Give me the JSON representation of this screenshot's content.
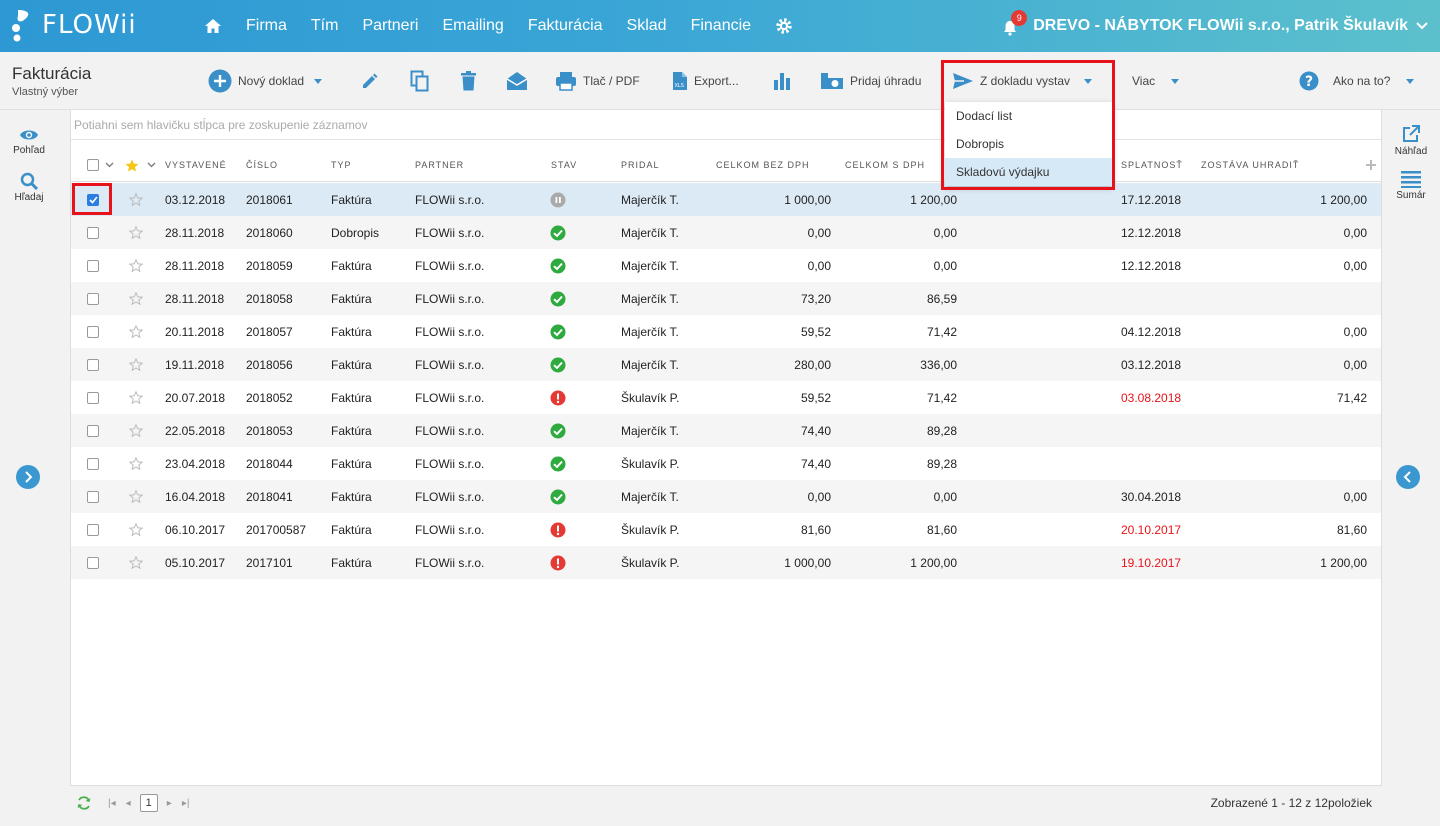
{
  "app": {
    "logo_text": "FLOWii",
    "brand_color": "#3399d6",
    "accent_color": "#3a8fc9"
  },
  "nav": {
    "items": [
      "Firma",
      "Tím",
      "Partneri",
      "Emailing",
      "Fakturácia",
      "Sklad",
      "Financie"
    ]
  },
  "user": {
    "notif_count": "9",
    "company": "DREVO - NÁBYTOK FLOWii s.r.o., Patrik Škulavík"
  },
  "page": {
    "title": "Fakturácia",
    "subtitle": "Vlastný výber"
  },
  "toolbar": {
    "new_doc": "Nový doklad",
    "print": "Tlač / PDF",
    "export": "Export...",
    "add_payment": "Pridaj úhradu",
    "from_doc": "Z dokladu vystav",
    "more": "Viac",
    "help": "Ako na to?"
  },
  "dropdown": {
    "items": [
      "Dodací list",
      "Dobropis",
      "Skladovú výdajku"
    ],
    "active_index": 2
  },
  "left_rail": {
    "view": "Pohľad",
    "search": "Hľadaj"
  },
  "right_rail": {
    "preview": "Náhľad",
    "summary": "Sumár"
  },
  "grid": {
    "group_hint": "Potiahni sem hlavičku stĺpca pre zoskupenie záznamov",
    "columns": {
      "issued": "VYSTAVENÉ",
      "number": "ČÍSLO",
      "type": "TYP",
      "partner": "PARTNER",
      "status": "STAV",
      "added_by": "PRIDAL",
      "total_no_vat": "CELKOM BEZ DPH",
      "total_vat": "CELKOM S DPH",
      "due": "SPLATNOSŤ",
      "remaining": "ZOSTÁVA UHRADIŤ"
    },
    "rows": [
      {
        "issued": "03.12.2018",
        "number": "2018061",
        "type": "Faktúra",
        "partner": "FLOWii s.r.o.",
        "status": "paused",
        "added_by": "Majerčík T.",
        "total_no_vat": "1 000,00",
        "total_vat": "1 200,00",
        "due": "17.12.2018",
        "remaining": "1 200,00",
        "overdue": false,
        "selected": true
      },
      {
        "issued": "28.11.2018",
        "number": "2018060",
        "type": "Dobropis",
        "partner": "FLOWii s.r.o.",
        "status": "ok",
        "added_by": "Majerčík T.",
        "total_no_vat": "0,00",
        "total_vat": "0,00",
        "due": "12.12.2018",
        "remaining": "0,00",
        "overdue": false,
        "selected": false
      },
      {
        "issued": "28.11.2018",
        "number": "2018059",
        "type": "Faktúra",
        "partner": "FLOWii s.r.o.",
        "status": "ok",
        "added_by": "Majerčík T.",
        "total_no_vat": "0,00",
        "total_vat": "0,00",
        "due": "12.12.2018",
        "remaining": "0,00",
        "overdue": false,
        "selected": false
      },
      {
        "issued": "28.11.2018",
        "number": "2018058",
        "type": "Faktúra",
        "partner": "FLOWii s.r.o.",
        "status": "ok",
        "added_by": "Majerčík T.",
        "total_no_vat": "73,20",
        "total_vat": "86,59",
        "due": "",
        "remaining": "",
        "overdue": false,
        "selected": false
      },
      {
        "issued": "20.11.2018",
        "number": "2018057",
        "type": "Faktúra",
        "partner": "FLOWii s.r.o.",
        "status": "ok",
        "added_by": "Majerčík T.",
        "total_no_vat": "59,52",
        "total_vat": "71,42",
        "due": "04.12.2018",
        "remaining": "0,00",
        "overdue": false,
        "selected": false
      },
      {
        "issued": "19.11.2018",
        "number": "2018056",
        "type": "Faktúra",
        "partner": "FLOWii s.r.o.",
        "status": "ok",
        "added_by": "Majerčík T.",
        "total_no_vat": "280,00",
        "total_vat": "336,00",
        "due": "03.12.2018",
        "remaining": "0,00",
        "overdue": false,
        "selected": false
      },
      {
        "issued": "20.07.2018",
        "number": "2018052",
        "type": "Faktúra",
        "partner": "FLOWii s.r.o.",
        "status": "error",
        "added_by": "Škulavík P.",
        "total_no_vat": "59,52",
        "total_vat": "71,42",
        "due": "03.08.2018",
        "remaining": "71,42",
        "overdue": true,
        "selected": false
      },
      {
        "issued": "22.05.2018",
        "number": "2018053",
        "type": "Faktúra",
        "partner": "FLOWii s.r.o.",
        "status": "ok",
        "added_by": "Majerčík T.",
        "total_no_vat": "74,40",
        "total_vat": "89,28",
        "due": "",
        "remaining": "",
        "overdue": false,
        "selected": false
      },
      {
        "issued": "23.04.2018",
        "number": "2018044",
        "type": "Faktúra",
        "partner": "FLOWii s.r.o.",
        "status": "ok",
        "added_by": "Škulavík P.",
        "total_no_vat": "74,40",
        "total_vat": "89,28",
        "due": "",
        "remaining": "",
        "overdue": false,
        "selected": false
      },
      {
        "issued": "16.04.2018",
        "number": "2018041",
        "type": "Faktúra",
        "partner": "FLOWii s.r.o.",
        "status": "ok",
        "added_by": "Majerčík T.",
        "total_no_vat": "0,00",
        "total_vat": "0,00",
        "due": "30.04.2018",
        "remaining": "0,00",
        "overdue": false,
        "selected": false
      },
      {
        "issued": "06.10.2017",
        "number": "201700587",
        "type": "Faktúra",
        "partner": "FLOWii s.r.o.",
        "status": "error",
        "added_by": "Škulavík P.",
        "total_no_vat": "81,60",
        "total_vat": "81,60",
        "due": "20.10.2017",
        "remaining": "81,60",
        "overdue": true,
        "selected": false
      },
      {
        "issued": "05.10.2017",
        "number": "2017101",
        "type": "Faktúra",
        "partner": "FLOWii s.r.o.",
        "status": "error",
        "added_by": "Škulavík P.",
        "total_no_vat": "1 000,00",
        "total_vat": "1 200,00",
        "due": "19.10.2017",
        "remaining": "1 200,00",
        "overdue": true,
        "selected": false
      }
    ]
  },
  "pager": {
    "current_page": "1",
    "info": "Zobrazené 1 - 12 z 12položiek"
  },
  "colors": {
    "ok": "#2eaa3f",
    "error": "#e53935",
    "paused": "#aaaaaa",
    "overdue": "#e8131a",
    "highlight": "#e8131a"
  }
}
